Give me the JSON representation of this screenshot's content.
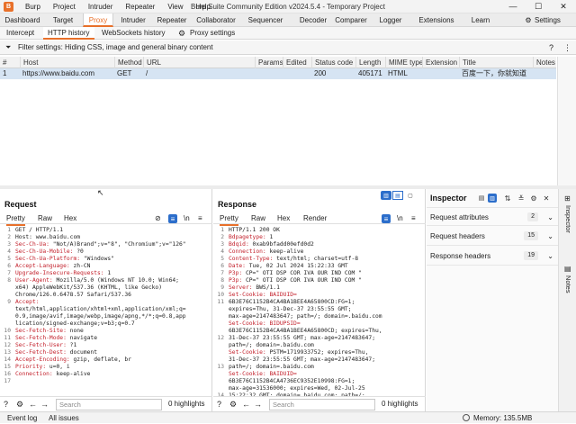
{
  "window": {
    "title": "Burp Suite Community Edition v2024.5.4 - Temporary Project",
    "minimize": "—",
    "maximize": "☐",
    "close": "✕",
    "logo_glyph": "B"
  },
  "menu": [
    "Burp",
    "Project",
    "Intruder",
    "Repeater",
    "View",
    "Help"
  ],
  "main_tabs": [
    "Dashboard",
    "Target",
    "Proxy",
    "Intruder",
    "Repeater",
    "Collaborator",
    "Sequencer",
    "Decoder",
    "Comparer",
    "Logger",
    "Extensions",
    "Learn",
    "Settings"
  ],
  "sub_tabs": [
    "Intercept",
    "HTTP history",
    "WebSockets history",
    "Proxy settings"
  ],
  "filter": {
    "text": "Filter settings: Hiding CSS, image and general binary content"
  },
  "table": {
    "columns": [
      "#",
      "Host",
      "Method",
      "URL",
      "Params",
      "Edited",
      "Status code",
      "Length",
      "MIME type",
      "Extension",
      "Title",
      "Notes"
    ],
    "rows": [
      [
        "1",
        "https://www.baidu.com",
        "GET",
        "/",
        "",
        "",
        "200",
        "405171",
        "HTML",
        "",
        "百度一下，你就知道",
        ""
      ]
    ]
  },
  "request": {
    "title": "Request",
    "tabs": [
      "Pretty",
      "Raw",
      "Hex"
    ],
    "line_numbers": [
      "1",
      "2",
      "3",
      "4",
      "5",
      "6",
      "7",
      "8",
      "",
      "",
      "9",
      "",
      "",
      "",
      "10",
      "11",
      "12",
      "13",
      "14",
      "15",
      "16",
      "17"
    ],
    "lines": [
      [
        "",
        "GET / HTTP/1.1"
      ],
      [
        "",
        "Host: www.baidu.com"
      ],
      [
        "Sec-Ch-Ua:",
        " \"Not/A)Brand\";v=\"8\", \"Chromium\";v=\"126\""
      ],
      [
        "Sec-Ch-Ua-Mobile:",
        " ?0"
      ],
      [
        "Sec-Ch-Ua-Platform:",
        " \"Windows\""
      ],
      [
        "Accept-Language:",
        " zh-CN"
      ],
      [
        "Upgrade-Insecure-Requests:",
        " 1"
      ],
      [
        "User-Agent:",
        " Mozilla/5.0 (Windows NT 10.0; Win64;"
      ],
      [
        "",
        "x64) AppleWebKit/537.36 (KHTML, like Gecko)"
      ],
      [
        "",
        "Chrome/126.0.6478.57 Safari/537.36"
      ],
      [
        "Accept:",
        ""
      ],
      [
        "",
        "text/html,application/xhtml+xml,application/xml;q="
      ],
      [
        "",
        "0.9,image/avif,image/webp,image/apng,*/*;q=0.8,app"
      ],
      [
        "",
        "lication/signed-exchange;v=b3;q=0.7"
      ],
      [
        "Sec-Fetch-Site:",
        " none"
      ],
      [
        "Sec-Fetch-Mode:",
        " navigate"
      ],
      [
        "Sec-Fetch-User:",
        " ?1"
      ],
      [
        "Sec-Fetch-Dest:",
        " document"
      ],
      [
        "Accept-Encoding:",
        " gzip, deflate, br"
      ],
      [
        "Priority:",
        " u=0, i"
      ],
      [
        "Connection:",
        " keep-alive"
      ],
      [
        "",
        ""
      ]
    ],
    "search_placeholder": "Search",
    "highlights": "0 highlights"
  },
  "response": {
    "title": "Response",
    "tabs": [
      "Pretty",
      "Raw",
      "Hex",
      "Render"
    ],
    "line_numbers": [
      "1",
      "2",
      "3",
      "4",
      "5",
      "6",
      "7",
      "8",
      "9",
      "10",
      "11",
      "",
      "",
      "",
      "",
      "12",
      "",
      "",
      "",
      "13",
      "",
      "",
      "",
      "14",
      "",
      ""
    ],
    "lines": [
      [
        "",
        "HTTP/1.1 200 OK"
      ],
      [
        "Bdpagetype:",
        " 1"
      ],
      [
        "Bdqid:",
        " 0xab9bfadd00efd0d2"
      ],
      [
        "Connection:",
        " keep-alive"
      ],
      [
        "Content-Type:",
        " text/html; charset=utf-8"
      ],
      [
        "Date:",
        " Tue, 02 Jul 2024 15:22:33 GMT"
      ],
      [
        "P3p:",
        " CP=\" OTI DSP COR IVA OUR IND COM \""
      ],
      [
        "P3p:",
        " CP=\" OTI DSP COR IVA OUR IND COM \""
      ],
      [
        "Server:",
        " BWS/1.1"
      ],
      [
        "Set-Cookie: BAIDUID=",
        ""
      ],
      [
        "",
        "6B3E76C1152B4CA4BA1BEE4A65800CD:FG=1;"
      ],
      [
        "",
        "expires=Thu, 31-Dec-37 23:55:55 GMT;"
      ],
      [
        "",
        "max-age=2147483647; path=/; domain=.baidu.com"
      ],
      [
        "Set-Cookie: BIDUPSID=",
        ""
      ],
      [
        "",
        "6B3E76C1152B4CA4BA1BEE4A65800CD; expires=Thu,"
      ],
      [
        "",
        "31-Dec-37 23:55:55 GMT; max-age=2147483647;"
      ],
      [
        "",
        "path=/; domain=.baidu.com"
      ],
      [
        "Set-Cookie:",
        " PSTM=1719933752; expires=Thu,"
      ],
      [
        "",
        "31-Dec-37 23:55:55 GMT; max-age=2147483647;"
      ],
      [
        "",
        "path=/; domain=.baidu.com"
      ],
      [
        "Set-Cookie: BAIDUID=",
        ""
      ],
      [
        "",
        "6B3E76C1152B4CA4736EC9352E10998:FG=1;"
      ],
      [
        "",
        "max-age=31536000; expires=Wed, 02-Jul-25"
      ],
      [
        "",
        "15:22:32 GMT; domain=.baidu.com; path=/;"
      ]
    ],
    "search_placeholder": "Search",
    "highlights": "0 highlights"
  },
  "inspector": {
    "title": "Inspector",
    "sections": [
      {
        "label": "Request attributes",
        "count": "2"
      },
      {
        "label": "Request headers",
        "count": "15"
      },
      {
        "label": "Response headers",
        "count": "19"
      }
    ],
    "side_tabs": [
      "Inspector",
      "Notes"
    ]
  },
  "status_bar": {
    "event_log": "Event log",
    "all_issues": "All issues",
    "memory": "Memory: 135.5MB"
  },
  "colors": {
    "accent": "#e8702a",
    "selected_row": "#d6e4f3",
    "header_key": "#c3202b",
    "button_blue": "#2c6ecb"
  }
}
